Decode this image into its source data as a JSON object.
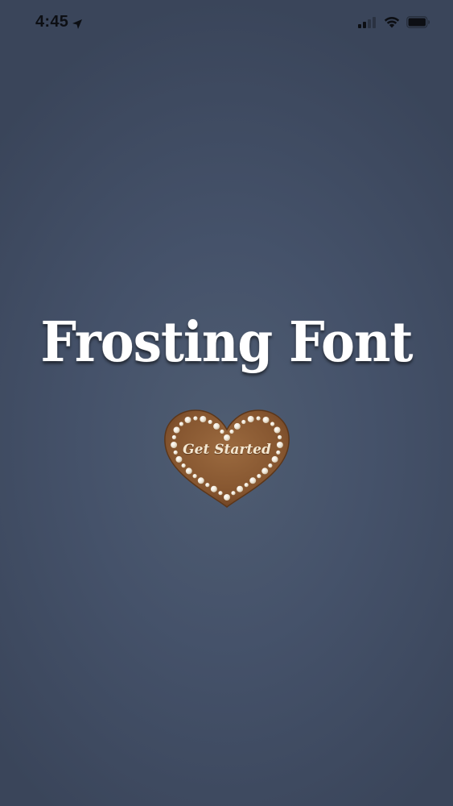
{
  "status_bar": {
    "time": "4:45",
    "icons": {
      "location": "location-arrow-icon",
      "signal": "cellular-signal-icon",
      "wifi": "wifi-icon",
      "battery": "battery-icon"
    }
  },
  "main": {
    "title": "Frosting Font",
    "get_started_label": "Get Started"
  },
  "colors": {
    "background": "#45526a",
    "title": "#ffffff",
    "cookie": "#8a5a33",
    "frosting": "#f3ece0"
  }
}
